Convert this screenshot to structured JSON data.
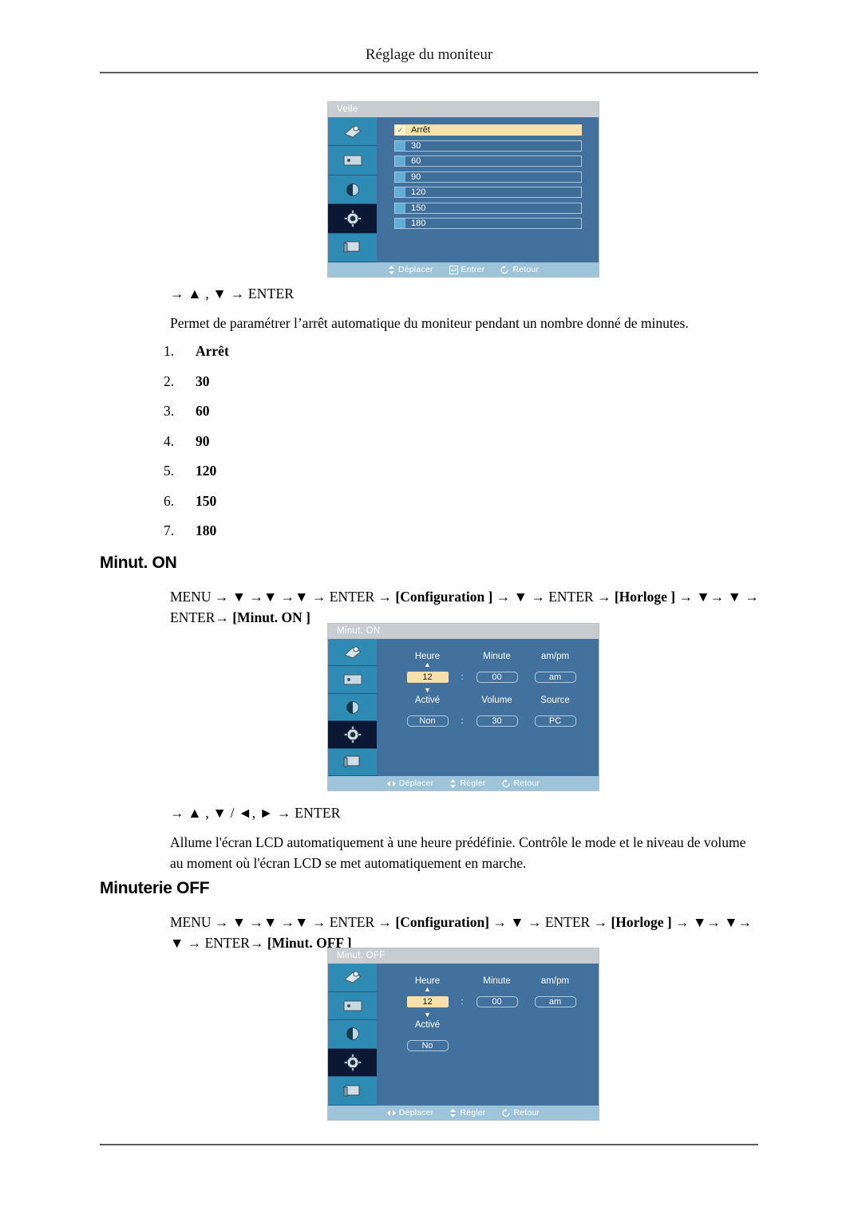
{
  "page": {
    "header": "Réglage du moniteur"
  },
  "veille_osd": {
    "title": "Veile",
    "options": [
      {
        "label": "Arrêt",
        "selected": true
      },
      {
        "label": "30",
        "selected": false
      },
      {
        "label": "60",
        "selected": false
      },
      {
        "label": "90",
        "selected": false
      },
      {
        "label": "120",
        "selected": false
      },
      {
        "label": "150",
        "selected": false
      },
      {
        "label": "180",
        "selected": false
      }
    ],
    "footer": {
      "move": "Déplacer",
      "enter": "Entrer",
      "return": "Retour"
    },
    "check_glyph": "✓"
  },
  "veille_section": {
    "keys": "→ ▲ , ▼ → ENTER",
    "description": "Permet de paramétrer l’arrêt automatique du moniteur pendant un nombre donné de minutes.",
    "list": [
      {
        "index": "1.",
        "value": "Arrêt"
      },
      {
        "index": "2.",
        "value": "30"
      },
      {
        "index": "3.",
        "value": "60"
      },
      {
        "index": "4.",
        "value": "90"
      },
      {
        "index": "5.",
        "value": "120"
      },
      {
        "index": "6.",
        "value": "150"
      },
      {
        "index": "7.",
        "value": "180"
      }
    ]
  },
  "minut_on": {
    "heading": "Minut. ON",
    "path_line1_pre": "MENU → ▼ →▼ →▼ → ENTER → ",
    "path_cfg": "[Configuration ]",
    "path_mid": " → ▼ → ENTER → ",
    "path_horloge": "[Horloge ]",
    "path_tail": " → ▼→ ▼ →",
    "path_line2_pre": "ENTER→ ",
    "path_name": "[Minut. ON ]",
    "keys": "→ ▲ , ▼ / ◄, ► → ENTER",
    "description": "Allume l'écran LCD automatiquement à une heure prédéfinie. Contrôle le mode et le niveau de volume au moment où l'écran LCD se met automatiquement en marche.",
    "osd": {
      "title": "Minut. ON",
      "labels": {
        "hour": "Heure",
        "minute": "Minute",
        "ampm": "am/pm",
        "active": "Activé",
        "volume": "Volume",
        "source": "Source"
      },
      "values": {
        "hour": "12",
        "minute": "00",
        "ampm": "am",
        "active": "Non",
        "volume": "30",
        "source": "PC"
      },
      "separator": ":",
      "arrow_up": "▲",
      "arrow_down": "▼",
      "footer": {
        "move": "Déplacer",
        "adjust": "Régler",
        "return": "Retour"
      }
    }
  },
  "minut_off": {
    "heading": "Minuterie OFF",
    "path_line1_pre": "MENU → ▼ →▼ →▼ → ENTER → ",
    "path_cfg": "[Configuration]",
    "path_mid": " → ▼ → ENTER → ",
    "path_horloge": "[Horloge ]",
    "path_tail": " → ▼→ ▼→ ▼",
    "path_line2_pre": "→ ENTER→ ",
    "path_name": "[Minut. OFF ]",
    "osd": {
      "title": "Minut. OFF",
      "labels": {
        "hour": "Heure",
        "minute": "Minute",
        "ampm": "am/pm",
        "active": "Activé"
      },
      "values": {
        "hour": "12",
        "minute": "00",
        "ampm": "am",
        "active": "No"
      },
      "separator": ":",
      "arrow_up": "▲",
      "arrow_down": "▼",
      "footer": {
        "move": "Déplacer",
        "adjust": "Régler",
        "return": "Retour"
      }
    }
  },
  "icons": {
    "sidebar": [
      "picture-icon",
      "screen-icon",
      "color-icon",
      "setup-gear-icon",
      "display-icon"
    ],
    "footer_move": "updown-arrow-icon",
    "footer_enter": "enter-key-icon",
    "footer_return": "return-circle-icon",
    "footer_move_lr": "leftright-arrow-icon"
  }
}
